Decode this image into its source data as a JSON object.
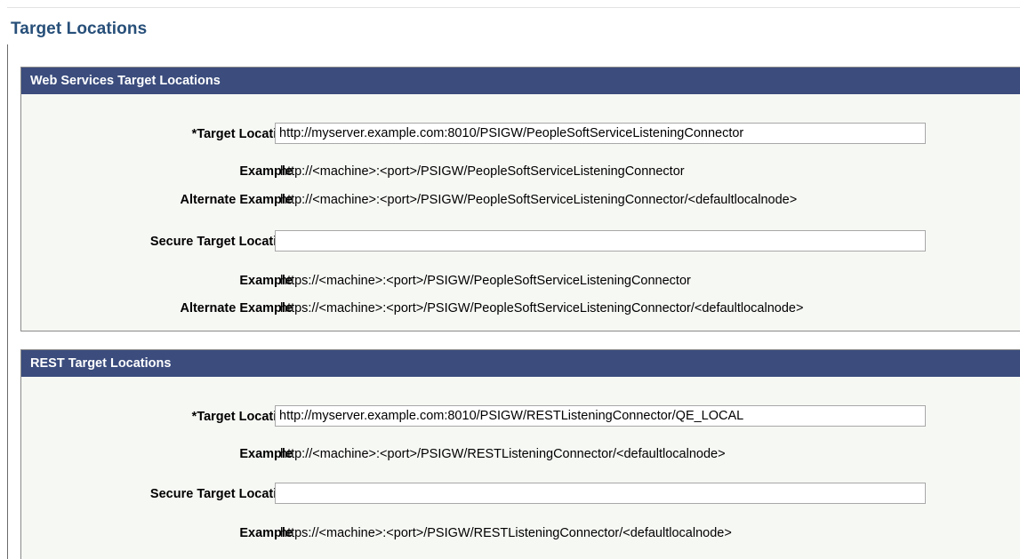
{
  "page_title": "Target Locations",
  "web_services": {
    "header": "Web Services Target Locations",
    "target_label": "*Target Location",
    "target_value": "http://myserver.example.com:8010/PSIGW/PeopleSoftServiceListeningConnector",
    "example_label": "Example",
    "example_value": "http://<machine>:<port>/PSIGW/PeopleSoftServiceListeningConnector",
    "alt_example_label": "Alternate Example",
    "alt_example_value": "http://<machine>:<port>/PSIGW/PeopleSoftServiceListeningConnector/<defaultlocalnode>",
    "secure_label": "Secure Target Location",
    "secure_value": "",
    "secure_example_label": "Example",
    "secure_example_value": "https://<machine>:<port>/PSIGW/PeopleSoftServiceListeningConnector",
    "secure_alt_example_label": "Alternate Example",
    "secure_alt_example_value": "https://<machine>:<port>/PSIGW/PeopleSoftServiceListeningConnector/<defaultlocalnode>"
  },
  "rest": {
    "header": "REST Target Locations",
    "target_label": "*Target Location",
    "target_value": "http://myserver.example.com:8010/PSIGW/RESTListeningConnector/QE_LOCAL",
    "example_label": "Example",
    "example_value": "http://<machine>:<port>/PSIGW/RESTListeningConnector/<defaultlocalnode>",
    "secure_label": "Secure Target Location",
    "secure_value": "",
    "secure_example_label": "Example",
    "secure_example_value": "https://<machine>:<port>/PSIGW/RESTListeningConnector/<defaultlocalnode>"
  }
}
